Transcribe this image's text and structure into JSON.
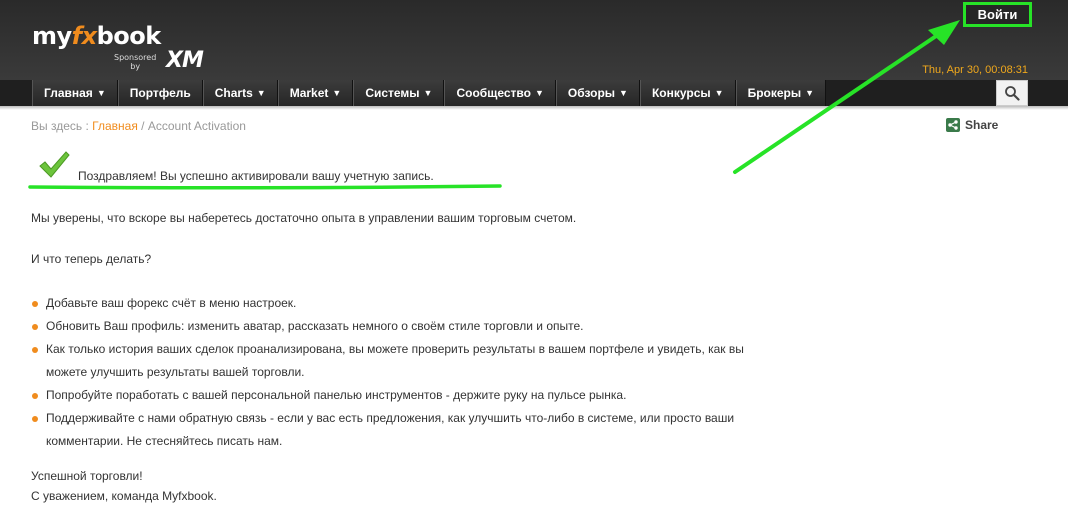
{
  "header": {
    "logo_text_pre": "my",
    "logo_text_fx": "fx",
    "logo_text_post": "book",
    "sponsored_line1": "Sponsored",
    "sponsored_line2": "by",
    "sponsor_logo": "XM",
    "login_label": "Войти",
    "datetime": "Thu, Apr 30, 00:08:31"
  },
  "nav": {
    "items": [
      {
        "label": "Главная",
        "has_dropdown": true
      },
      {
        "label": "Портфель",
        "has_dropdown": false
      },
      {
        "label": "Charts",
        "has_dropdown": true
      },
      {
        "label": "Market",
        "has_dropdown": true
      },
      {
        "label": "Системы",
        "has_dropdown": true
      },
      {
        "label": "Сообщество",
        "has_dropdown": true
      },
      {
        "label": "Обзоры",
        "has_dropdown": true
      },
      {
        "label": "Конкурсы",
        "has_dropdown": true
      },
      {
        "label": "Брокеры",
        "has_dropdown": true
      }
    ],
    "dropdown_arrow": "▼",
    "search_icon": "search-icon"
  },
  "breadcrumb": {
    "prefix": "Вы здесь :",
    "home": "Главная",
    "separator": "/",
    "current": "Account Activation"
  },
  "share": {
    "label": "Share",
    "icon": "share-icon"
  },
  "content": {
    "success_message": "Поздравляем! Вы успешно активировали вашу учетную запись.",
    "intro": "Мы уверены, что вскоре вы наберетесь достаточно опыта в управлении вашим торговым счетом.",
    "question": "И что теперь делать?",
    "steps": [
      {
        "line1": "Добавьте ваш форекс счёт в меню настроек.",
        "line2": ""
      },
      {
        "line1": "Обновить Ваш профиль: изменить аватар, рассказать немного о своём стиле торговли и опыте.",
        "line2": ""
      },
      {
        "line1": "Как только история ваших сделок проанализирована, вы можете проверить результаты в вашем портфеле и увидеть, как вы",
        "line2": "можете улучшить результаты вашей торговли."
      },
      {
        "line1": "Попробуйте поработать с вашей персональной панелью инструментов - держите руку на пульсе рынка.",
        "line2": ""
      },
      {
        "line1": "Поддерживайте с нами обратную связь - если у вас есть предложения, как улучшить что-либо в системе, или просто ваши",
        "line2": "комментарии. Не стесняйтесь писать нам."
      }
    ],
    "closing1": "Успешной торговли!",
    "closing2": "С уважением, команда Myfxbook."
  },
  "colors": {
    "accent": "#f08c1e",
    "annotation_green": "#27e327",
    "date_color": "#f0a81c"
  }
}
